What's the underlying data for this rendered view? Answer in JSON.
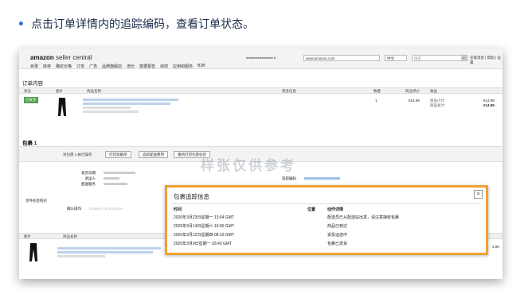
{
  "instruction": {
    "bullet": "•",
    "text": "点击订单详情内的追踪编码，查看订单状态。"
  },
  "header": {
    "logo": "amazon",
    "logo_sub": "seller central",
    "flag": "⚐",
    "marketplace": "www.amazon.com",
    "language": "中文",
    "search_placeholder": "搜索",
    "links": "买家消息 | 帮助 | 设置",
    "nav": [
      "目录",
      "库存",
      "确定价格",
      "订单",
      "广告",
      "品牌旗舰店",
      "增长",
      "数据报告",
      "绩效",
      "应用和服务",
      "B2B"
    ]
  },
  "order": {
    "heading": "订单内容",
    "columns": {
      "status": "状态",
      "image": "图片",
      "name": "商品名称",
      "more": "更多信息",
      "qty": "数量",
      "unit_price": "商品单价",
      "proceeds": "收益"
    },
    "status": "已发货",
    "quantity": "1",
    "price": "€14.99",
    "subtotal_label": "商品小计:",
    "total_label": "商品总计:",
    "subtotal_value": "€14.99",
    "total_value": "€14.99"
  },
  "package": {
    "heading": "包裹 1",
    "label": "对包裹 1 执行操作",
    "buttons": [
      "打印装箱单",
      "追踪配送费用",
      "重新打印包裹标签"
    ],
    "fields": {
      "ship_date": "发货日期",
      "carrier": "承运人",
      "service": "配送服务",
      "tracking": "追踪编码"
    },
    "watermark": "样张仅供参考"
  },
  "other": {
    "section": "货件标签购买",
    "confirm_label": "确认操作:",
    "confirm_value": "Delivery confirmation",
    "col_image": "图片",
    "col_name": "商品名称",
    "partial_price": "4.99"
  },
  "popup": {
    "title": "包裹追踪信息",
    "close": "×",
    "headers": {
      "time": "时间",
      "location": "位置",
      "detail": "动作详情"
    },
    "rows": [
      {
        "time": "2020年3月23日星期一 13:04 GMT",
        "location": "",
        "detail": "配送员已从配送站出发，请注意接收包裹"
      },
      {
        "time": "2020年3月14日星期六 10:00 GMT",
        "location": "",
        "detail": "商品已到达"
      },
      {
        "time": "2020年3月12日星期四 08:10 GMT",
        "location": "",
        "detail": "妥投运途中"
      },
      {
        "time": "2020年3月9日星期一 03:40 GMT",
        "location": "",
        "detail": "包裹已发货"
      }
    ]
  }
}
